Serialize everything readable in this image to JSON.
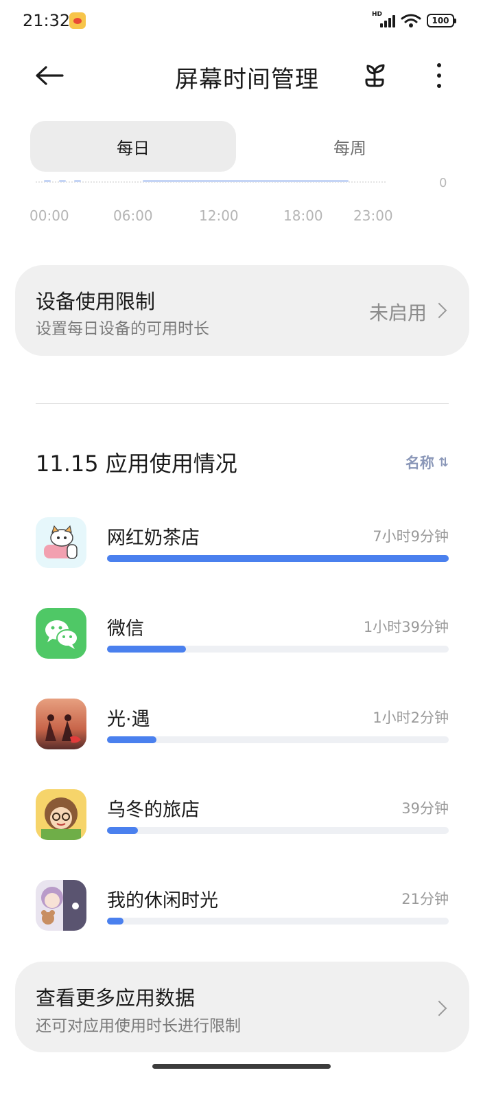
{
  "status_bar": {
    "time": "21:32",
    "network_label": "HD",
    "battery": "100",
    "icons": [
      "weibo-notification-icon",
      "signal-icon",
      "wifi-icon",
      "battery-icon"
    ]
  },
  "header": {
    "title": "屏幕时间管理",
    "icons": [
      "back-arrow-icon",
      "sprout-icon",
      "more-vertical-icon"
    ]
  },
  "tabs": [
    {
      "label": "每日",
      "active": true
    },
    {
      "label": "每周",
      "active": false
    }
  ],
  "timeline_chart": {
    "y_zero_label": "0",
    "x_ticks": [
      "00:00",
      "06:00",
      "12:00",
      "18:00",
      "23:00"
    ]
  },
  "device_limit": {
    "title": "设备使用限制",
    "subtitle": "设置每日设备的可用时长",
    "status": "未启用"
  },
  "app_usage": {
    "title": "11.15 应用使用情况",
    "sort_label": "名称",
    "sort_icon": "sort-arrows-icon",
    "apps": [
      {
        "name": "网红奶茶店",
        "time": "7小时9分钟",
        "fraction": 1.0,
        "icon": "milk-tea-shop-app-icon"
      },
      {
        "name": "微信",
        "time": "1小时39分钟",
        "fraction": 0.231,
        "icon": "wechat-app-icon"
      },
      {
        "name": "光·遇",
        "time": "1小时2分钟",
        "fraction": 0.145,
        "icon": "sky-app-icon"
      },
      {
        "name": "乌冬的旅店",
        "time": "39分钟",
        "fraction": 0.091,
        "icon": "udon-inn-app-icon"
      },
      {
        "name": "我的休闲时光",
        "time": "21分钟",
        "fraction": 0.049,
        "icon": "leisure-time-app-icon"
      }
    ]
  },
  "more_data": {
    "title": "查看更多应用数据",
    "subtitle": "还可对应用使用时长进行限制"
  },
  "colors": {
    "accent": "#4a80ee",
    "card_bg": "#f0f0f0",
    "track_bg": "#eef0f4"
  }
}
